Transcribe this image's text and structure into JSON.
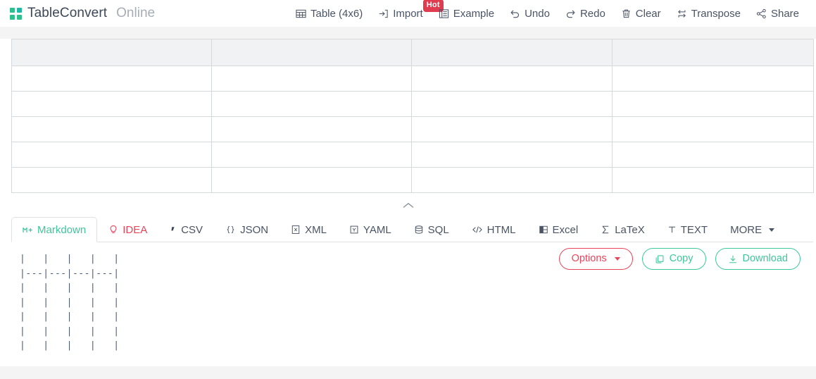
{
  "brand": {
    "name": "TableConvert",
    "suffix": "Online",
    "logo_icon": "four-squares-logo-icon"
  },
  "toolbar": {
    "items": [
      {
        "label": "Table (4x6)",
        "icon": "table-grid-icon",
        "badge": null
      },
      {
        "label": "Import",
        "icon": "import-arrow-icon",
        "badge": "Hot"
      },
      {
        "label": "Example",
        "icon": "example-list-icon",
        "badge": null
      },
      {
        "label": "Undo",
        "icon": "undo-arrow-icon",
        "badge": null
      },
      {
        "label": "Redo",
        "icon": "redo-arrow-icon",
        "badge": null
      },
      {
        "label": "Clear",
        "icon": "trash-can-icon",
        "badge": null
      },
      {
        "label": "Transpose",
        "icon": "transpose-swap-icon",
        "badge": null
      },
      {
        "label": "Share",
        "icon": "share-nodes-icon",
        "badge": null
      }
    ]
  },
  "table_editor": {
    "rows": 6,
    "columns": 4,
    "header": [
      "",
      "",
      "",
      ""
    ],
    "body": [
      [
        "",
        "",
        "",
        ""
      ],
      [
        "",
        "",
        "",
        ""
      ],
      [
        "",
        "",
        "",
        ""
      ],
      [
        "",
        "",
        "",
        ""
      ],
      [
        "",
        "",
        "",
        ""
      ]
    ],
    "header_bg": "#f1f2f3",
    "border_color": "#d6d9dc"
  },
  "collapse": {
    "icon": "chevron-up-icon"
  },
  "tabs": {
    "active": "Markdown",
    "items": [
      {
        "label": "Markdown",
        "icon": "markdown-m-icon",
        "active": true,
        "color": "#3ec79b"
      },
      {
        "label": "IDEA",
        "icon": "lightbulb-icon",
        "active": false,
        "color": "#e8445a"
      },
      {
        "label": "CSV",
        "icon": "comma-icon",
        "active": false,
        "color": "#4a5464"
      },
      {
        "label": "JSON",
        "icon": "curly-braces-icon",
        "active": false,
        "color": "#4a5464"
      },
      {
        "label": "XML",
        "icon": "xml-document-icon",
        "active": false,
        "color": "#4a5464"
      },
      {
        "label": "YAML",
        "icon": "yaml-box-icon",
        "active": false,
        "color": "#4a5464"
      },
      {
        "label": "SQL",
        "icon": "database-icon",
        "active": false,
        "color": "#4a5464"
      },
      {
        "label": "HTML",
        "icon": "angle-brackets-icon",
        "active": false,
        "color": "#4a5464"
      },
      {
        "label": "Excel",
        "icon": "excel-sheet-icon",
        "active": false,
        "color": "#4a5464"
      },
      {
        "label": "LaTeX",
        "icon": "sigma-icon",
        "active": false,
        "color": "#4a5464"
      },
      {
        "label": "TEXT",
        "icon": "text-t-icon",
        "active": false,
        "color": "#4a5464"
      },
      {
        "label": "MORE",
        "icon": "chevron-down-icon",
        "active": false,
        "color": "#4a5464"
      }
    ]
  },
  "output": {
    "format": "Markdown",
    "code": "|   |   |   |   |\n|---|---|---|---|\n|   |   |   |   |\n|   |   |   |   |\n|   |   |   |   |\n|   |   |   |   |\n|   |   |   |   |"
  },
  "actions": {
    "options": {
      "label": "Options",
      "color": "#e8445a",
      "icon": "caret-down-icon"
    },
    "copy": {
      "label": "Copy",
      "color": "#3ec79b",
      "icon": "copy-pages-icon"
    },
    "download": {
      "label": "Download",
      "color": "#3ec79b",
      "icon": "download-arrow-icon"
    }
  }
}
